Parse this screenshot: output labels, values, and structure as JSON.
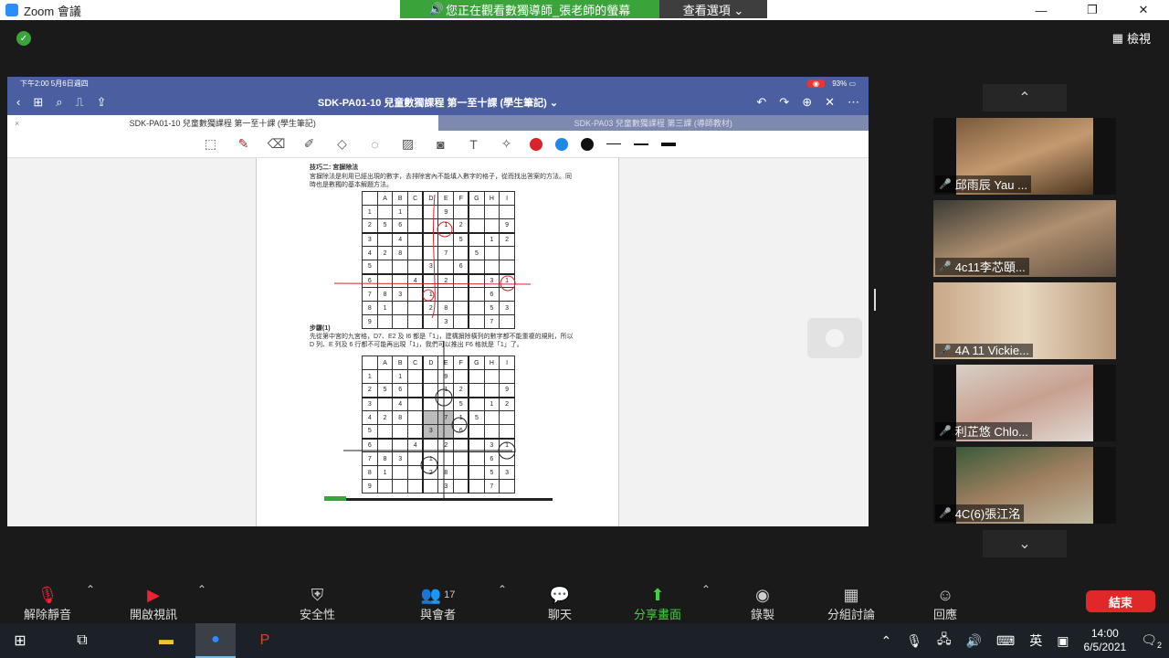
{
  "window": {
    "app_title": "Zoom 會議",
    "minimize": "—",
    "maximize": "❐",
    "close": "✕"
  },
  "share_banner": {
    "message": "您正在觀看數獨導師_張老師的螢幕",
    "options": "查看選項 ⌄"
  },
  "header": {
    "view_label": "檢視"
  },
  "ipad": {
    "time": "下午2:00   5月6日週四",
    "battery": "93%",
    "doc_title": "SDK-PA01-10 兒童數獨課程 第一至十課 (學生筆記) ⌄",
    "tabs": [
      {
        "label": "SDK-PA01-10 兒童數獨課程 第一至十課 (學生筆記)"
      },
      {
        "label": "SDK-PA03 兒童數獨課程 第三課 (導師教材)"
      }
    ],
    "colors": {
      "red": "#d9232a",
      "blue": "#1e88e5",
      "black": "#111111"
    }
  },
  "page": {
    "heading": "技巧二: 宮摒除法",
    "intro": "宮摒除法是利用已經出現的數字，去排除宮內不能填入數字的格子，從而找出答案的方法。同時也是數獨的基本解題方法。",
    "step": "步驟(1)",
    "step_text": "先從第中宮的九宮格，D7、E2 及 I6 都是「1」，建構摒除橫列的數字都不能重複的規則，所以 D 列、E 列及 6 行都不可能再出現「1」，我們可以推出 F6 格就是「1」了。",
    "col_headers": [
      "",
      "A",
      "B",
      "C",
      "D",
      "E",
      "F",
      "G",
      "H",
      "I"
    ],
    "grid1": [
      [
        "1",
        "",
        "1",
        "",
        "",
        "9",
        "",
        "",
        "",
        ""
      ],
      [
        "2",
        "5",
        "6",
        "",
        "",
        "1",
        "2",
        "",
        "",
        "9"
      ],
      [
        "3",
        "",
        "4",
        "",
        "",
        "",
        "5",
        "",
        "1",
        "2"
      ],
      [
        "4",
        "2",
        "8",
        "",
        "",
        "7",
        "",
        "5",
        "",
        ""
      ],
      [
        "5",
        "",
        "",
        "",
        "3",
        "",
        "6",
        "",
        "",
        ""
      ],
      [
        "6",
        "",
        "",
        "4",
        "",
        "2",
        "",
        "",
        "3",
        "1"
      ],
      [
        "7",
        "8",
        "3",
        "",
        "1",
        "",
        "",
        "",
        "6",
        ""
      ],
      [
        "8",
        "1",
        "",
        "",
        "2",
        "8",
        "",
        "",
        "5",
        "3"
      ],
      [
        "9",
        "",
        "",
        "",
        "",
        "3",
        "",
        "",
        "7",
        ""
      ]
    ],
    "grid2": [
      [
        "1",
        "",
        "1",
        "",
        "",
        "9",
        "",
        "",
        "",
        ""
      ],
      [
        "2",
        "5",
        "6",
        "",
        "",
        "1",
        "2",
        "",
        "",
        "9"
      ],
      [
        "3",
        "",
        "4",
        "",
        "",
        "",
        "5",
        "",
        "1",
        "2"
      ],
      [
        "4",
        "2",
        "8",
        "",
        "",
        "7",
        "1",
        "5",
        "",
        ""
      ],
      [
        "5",
        "",
        "",
        "",
        "3",
        "",
        "6",
        "",
        "",
        ""
      ],
      [
        "6",
        "",
        "",
        "4",
        "",
        "2",
        "",
        "",
        "3",
        "1"
      ],
      [
        "7",
        "8",
        "3",
        "",
        "1",
        "",
        "",
        "",
        "6",
        ""
      ],
      [
        "8",
        "1",
        "",
        "",
        "2",
        "8",
        "",
        "",
        "5",
        "3"
      ],
      [
        "9",
        "",
        "",
        "",
        "",
        "3",
        "",
        "",
        "7",
        ""
      ]
    ]
  },
  "gallery": {
    "participants": [
      {
        "name": "邱雨辰 Yau ..."
      },
      {
        "name": "4c11李芯頤..."
      },
      {
        "name": "4A 11 Vickie..."
      },
      {
        "name": "利芷悠 Chlo..."
      },
      {
        "name": "4C(6)張江洺"
      }
    ]
  },
  "toolbar": {
    "unmute": "解除靜音",
    "video": "開啟視訊",
    "security": "安全性",
    "participants": "與會者",
    "participants_count": "17",
    "chat": "聊天",
    "share": "分享畫面",
    "record": "錄製",
    "breakout": "分組討論",
    "reactions": "回應",
    "end": "結束"
  },
  "taskbar": {
    "ime": "英",
    "time": "14:00",
    "date": "6/5/2021",
    "notifications": "2"
  }
}
